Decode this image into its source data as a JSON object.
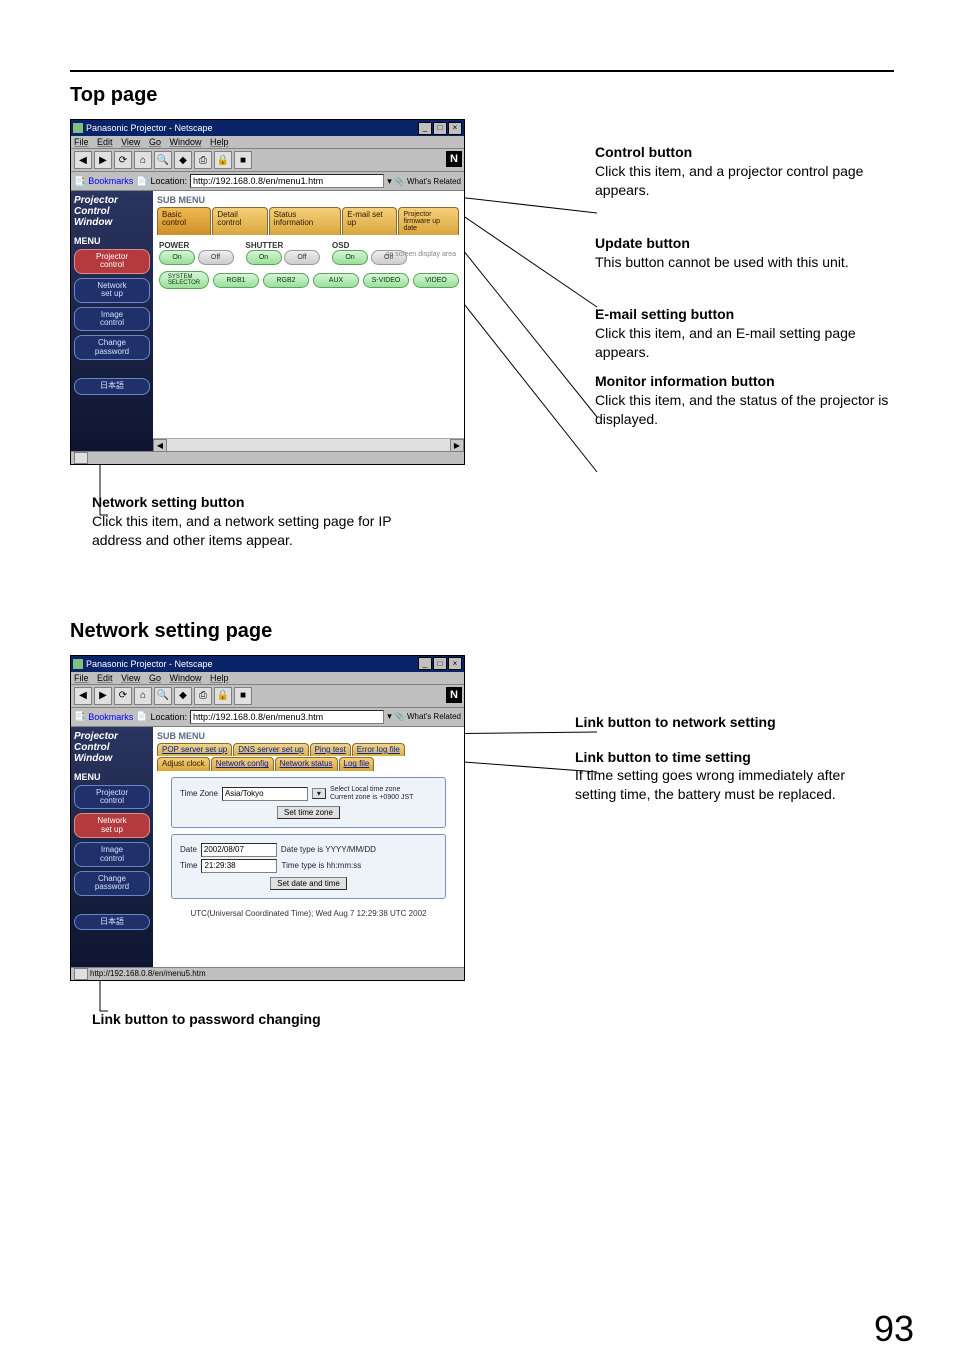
{
  "page_number": "93",
  "section1_title": "Top page",
  "section2_title": "Network setting page",
  "callouts_top": {
    "control": {
      "title": "Control button",
      "desc": "Click this item, and a projector control page appears."
    },
    "update": {
      "title": "Update button",
      "desc": "This button cannot be used with this unit."
    },
    "email": {
      "title": "E-mail setting button",
      "desc": "Click this item, and an E-mail setting page appears."
    },
    "monitor": {
      "title": "Monitor information button",
      "desc": "Click this item, and the status of the projector is displayed."
    },
    "network": {
      "title": "Network setting button",
      "desc": "Click this item, and a network setting page for IP address and other items appear."
    }
  },
  "callouts_net": {
    "link_net": {
      "title": "Link button to network setting"
    },
    "link_time": {
      "title": "Link button to time setting",
      "desc": "If time setting goes wrong immediately after setting time, the battery must be replaced."
    },
    "link_pw": {
      "title": "Link button to password changing"
    }
  },
  "ns_window": {
    "title": "Panasonic Projector - Netscape",
    "menu": [
      "File",
      "Edit",
      "View",
      "Go",
      "Window",
      "Help"
    ],
    "toolbar_icons": [
      "back-icon",
      "forward-icon",
      "reload-icon",
      "home-icon",
      "search-icon",
      "netscape-icon",
      "print-icon",
      "security-icon",
      "stop-icon"
    ],
    "bookmarks_label": "Bookmarks",
    "location_label": "Location:",
    "location1": "http://192.168.0.8/en/menu1.htm",
    "location2": "http://192.168.0.8/en/menu3.htm",
    "whats_related": "What's Related",
    "status2": "http://192.168.0.8/en/menu5.htm"
  },
  "projector_ui": {
    "logo_lines": [
      "Projector",
      "Control",
      "Window"
    ],
    "menu_label": "MENU",
    "side": {
      "projector_control": "Projector\ncontrol",
      "network_setup": "Network\nset up",
      "image_control": "Image\ncontrol",
      "change_password": "Change\npassword",
      "japanese": "日本語"
    },
    "sub_menu_label": "SUB MENU",
    "on_screen_note": "on screen display area",
    "tabs_top": {
      "basic": "Basic control",
      "detail": "Detail control",
      "status": "Status information",
      "email": "E-mail set up",
      "fw": "Projector\nfirmware up date"
    },
    "controls": {
      "power_label": "POWER",
      "shutter_label": "SHUTTER",
      "osd_label": "OSD",
      "on": "On",
      "off": "Off",
      "system_selector": "SYSTEM\nSELECTOR",
      "inputs": [
        "RGB1",
        "RGB2",
        "AUX",
        "S-VIDEO",
        "VIDEO"
      ]
    }
  },
  "net_ui": {
    "tabs_row1": [
      "POP server set up",
      "DNS server set up",
      "Ping test",
      "Error log file"
    ],
    "tabs_row2": [
      "Adjust clock",
      "Network config",
      "Network status",
      "Log file"
    ],
    "tz_label": "Time Zone",
    "tz_value": "Asia/Tokyo",
    "tz_note1": "Select Local time zone",
    "tz_note2": "Current zone is +0900 JST",
    "set_tz_btn": "Set time zone",
    "date_label": "Date",
    "date_value": "2002/08/07",
    "date_hint": "Date type is YYYY/MM/DD",
    "time_label": "Time",
    "time_value": "21:29:38",
    "time_hint": "Time type is hh:mm:ss",
    "set_dt_btn": "Set date and time",
    "utc_line": "UTC(Universal Coordinated Time);  Wed Aug 7 12:29:38 UTC 2002"
  }
}
